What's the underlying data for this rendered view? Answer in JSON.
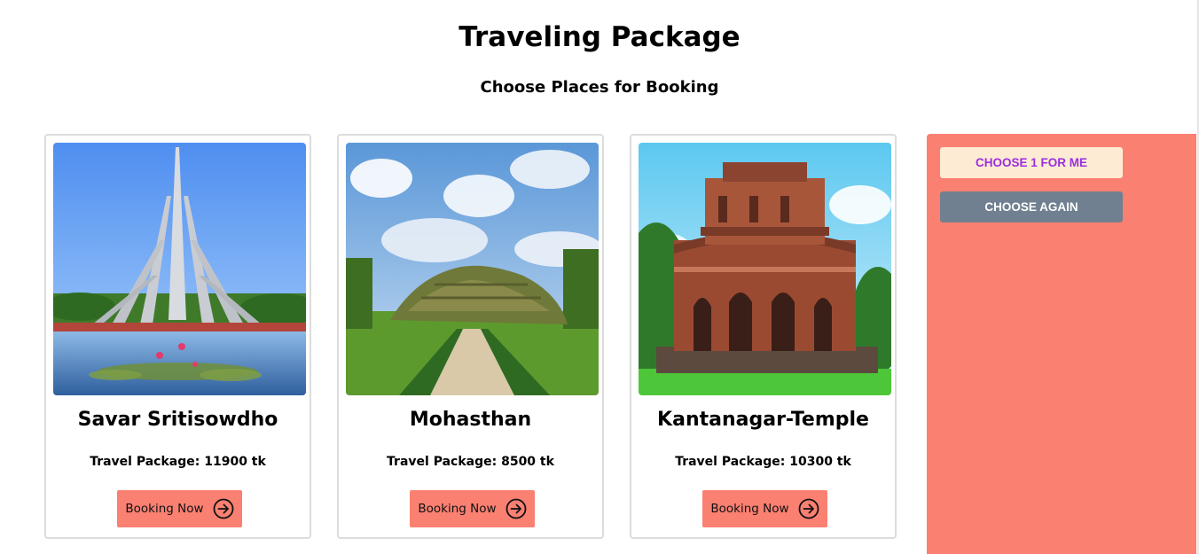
{
  "header": {
    "title": "Traveling Package",
    "subtitle": "Choose Places for Booking"
  },
  "cards": [
    {
      "image_icon": "national-memorial-photo",
      "name": "Savar Sritisowdho",
      "price_text": "Travel Package: 11900 tk",
      "button_label": "Booking Now",
      "button_icon": "arrow-right-circle-icon"
    },
    {
      "image_icon": "archaeological-mound-photo",
      "name": "Mohasthan",
      "price_text": "Travel Package: 8500 tk",
      "button_label": "Booking Now",
      "button_icon": "arrow-right-circle-icon"
    },
    {
      "image_icon": "terracotta-temple-photo",
      "name": "Kantanagar-Temple",
      "price_text": "Travel Package: 10300 tk",
      "button_label": "Booking Now",
      "button_icon": "arrow-right-circle-icon"
    }
  ],
  "sidebar": {
    "choose_label": "Choose 1 for me",
    "again_label": "Choose again"
  },
  "colors": {
    "accent": "#fa8072",
    "choose_bg": "#fdebd3",
    "choose_text": "#9b2fe0",
    "again_bg": "#708090"
  }
}
